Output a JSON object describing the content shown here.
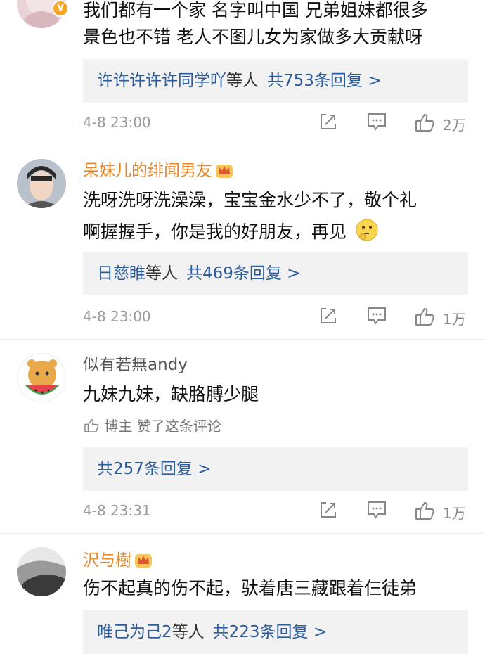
{
  "comments": [
    {
      "lines": [
        "我们都有一个家 名字叫中国 兄弟姐妹都很多",
        "景色也不错 老人不图儿女为家做多大贡献呀"
      ],
      "reply": {
        "users": "许许许许许同学吖",
        "suffix": "等人",
        "count": "共753条回复 >"
      },
      "date": "4-8 23:00",
      "likes": "2万"
    },
    {
      "username": "呆妹儿的绯闻男友",
      "lines": [
        "洗呀洗呀洗澡澡，宝宝金水少不了，敬个礼",
        "啊握握手，你是我的好朋友，再见"
      ],
      "reply": {
        "users": "日慈睢",
        "suffix": "等人",
        "count": "共469条回复 >"
      },
      "date": "4-8 23:00",
      "likes": "1万"
    },
    {
      "username": "似有若無andy",
      "lines": [
        "九妹九妹，缺胳膊少腿"
      ],
      "author_like": "博主 赞了这条评论",
      "reply": {
        "count": "共257条回复 >"
      },
      "date": "4-8 23:31",
      "likes": "1万"
    },
    {
      "username": "沢与樹",
      "lines": [
        "伤不起真的伤不起，驮着唐三藏跟着仨徒弟"
      ],
      "reply": {
        "users": "唯己为己2",
        "suffix": "等人",
        "count": "共223条回复 >"
      }
    }
  ],
  "icons": {
    "share": "share-icon",
    "comment": "comment-icon",
    "like": "thumbs-up-icon",
    "crown": "crown-badge-icon",
    "verified": "verified-badge-icon",
    "emoji": "thinking-emoji-icon"
  },
  "colors": {
    "link": "#2b5c9c",
    "gold_name": "#e8882b",
    "meta": "#999999",
    "reply_bg": "#f2f2f2"
  }
}
